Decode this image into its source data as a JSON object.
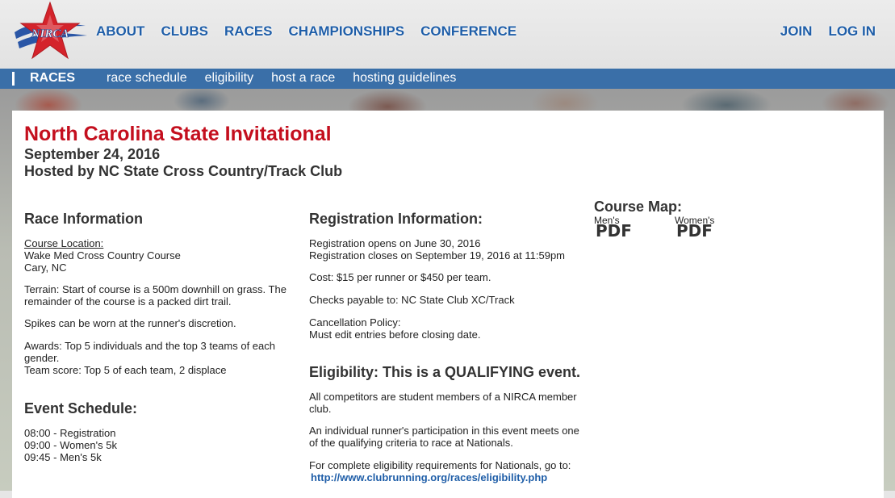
{
  "header": {
    "logo_text": "NIRCA",
    "nav": [
      "ABOUT",
      "CLUBS",
      "RACES",
      "CHAMPIONSHIPS",
      "CONFERENCE"
    ],
    "user_nav": [
      "JOIN",
      "LOG IN"
    ]
  },
  "subnav": {
    "section": "RACES",
    "items": [
      "race schedule",
      "eligibility",
      "host a race",
      "hosting guidelines"
    ]
  },
  "event": {
    "title": "North Carolina State Invitational",
    "date": "September 24, 2016",
    "host": "Hosted by NC State Cross Country/Track Club"
  },
  "race_info": {
    "heading": "Race Information",
    "location_label": "Course Location:",
    "location_line1": "Wake Med Cross Country Course",
    "location_line2": "Cary, NC",
    "terrain": "Terrain: Start of course is a 500m downhill on grass. The remainder of the course is a packed dirt trail.",
    "spikes": "Spikes can be worn at the runner's discretion.",
    "awards": "Awards: Top 5 individuals and the top 3 teams of each gender.",
    "team_score": "Team score: Top 5 of each team, 2 displace"
  },
  "schedule": {
    "heading": "Event Schedule:",
    "items": [
      "08:00 - Registration",
      "09:00 - Women's 5k",
      "09:45 - Men's 5k"
    ]
  },
  "registration": {
    "heading": "Registration Information:",
    "opens": "Registration opens on June 30, 2016",
    "closes": "Registration closes on September 19, 2016 at 11:59pm",
    "cost": "Cost: $15 per runner or $450 per team.",
    "checks": "Checks payable to: NC State Club XC/Track",
    "cancel_label": "Cancellation Policy:",
    "cancel_text": "Must edit entries before closing date."
  },
  "eligibility": {
    "heading": "Eligibility: This is a QUALIFYING event.",
    "p1": "All competitors are student members of a NIRCA member club.",
    "p2": "An individual runner's participation in this event meets one of the qualifying criteria to race at Nationals.",
    "p3": "For complete eligibility requirements for Nationals, go to:",
    "link": "http://www.clubrunning.org/races/eligibility.php"
  },
  "course_map": {
    "heading": "Course Map:",
    "men_label": "Men's",
    "women_label": "Women's",
    "men_pdf": "PDF",
    "women_pdf": "PDF"
  },
  "colors": {
    "nav_blue": "#1f5ea8",
    "subbar_blue": "#3a6fa8",
    "title_red": "#c40f1e"
  }
}
